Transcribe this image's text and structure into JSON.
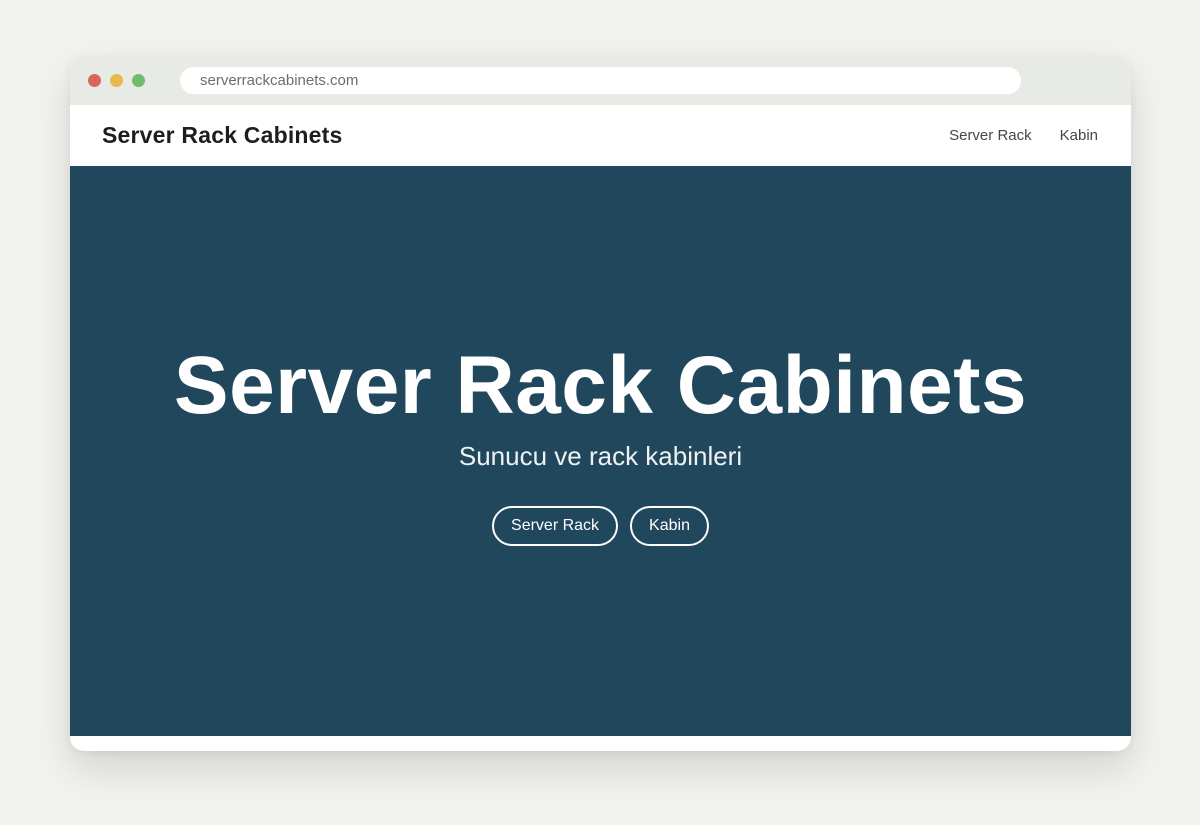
{
  "browser": {
    "url": "serverrackcabinets.com"
  },
  "navbar": {
    "brand": "Server Rack Cabinets",
    "links": [
      "Server Rack",
      "Kabin"
    ]
  },
  "hero": {
    "title": "Server Rack Cabinets",
    "subtitle": "Sunucu ve rack kabinleri",
    "buttons": [
      "Server Rack",
      "Kabin"
    ]
  },
  "colors": {
    "hero_background": "#20475c",
    "page_background": "#f2f2ee",
    "window_dot_red": "#d9665a",
    "window_dot_yellow": "#e6b94a",
    "window_dot_green": "#71bb6e"
  }
}
